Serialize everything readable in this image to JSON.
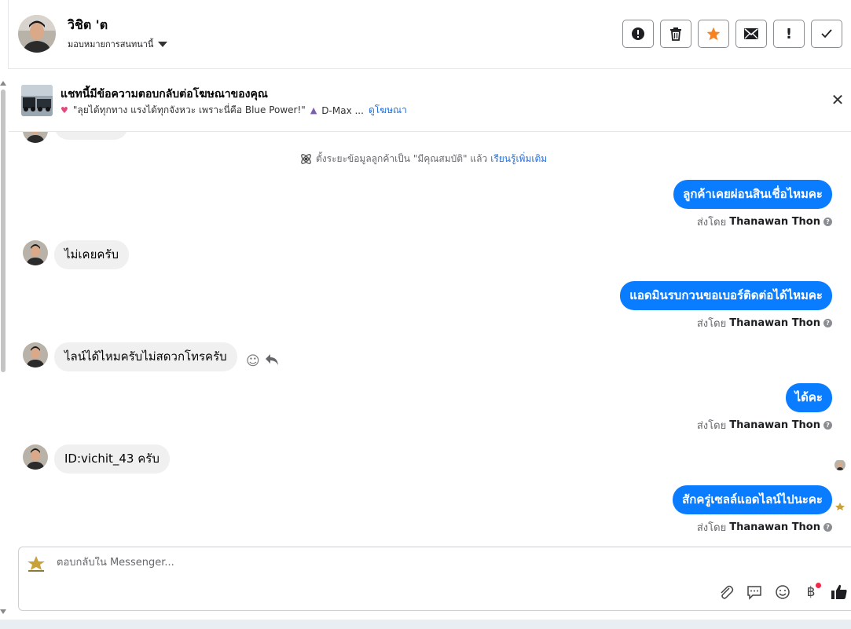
{
  "header": {
    "contact_name": "วิชิต 'ต",
    "assign_label": "มอบหมายการสนทนานี้",
    "actions": [
      {
        "name": "spam",
        "glyph": "!"
      },
      {
        "name": "trash",
        "glyph": "trash"
      },
      {
        "name": "star",
        "glyph": "★"
      },
      {
        "name": "mail",
        "glyph": "✉"
      },
      {
        "name": "follow-up",
        "glyph": "!"
      },
      {
        "name": "done",
        "glyph": "✓"
      }
    ]
  },
  "ad_banner": {
    "title": "แชทนี้มีข้อความตอบกลับต่อโฆษณาของคุณ",
    "ad_text": "\"ลุยได้ทุกทาง แรงได้ทุกจังหวะ เพราะนี่คือ Blue Power!\"",
    "ad_suffix": "D-Max ...",
    "link_label": "ดูโฆษณา"
  },
  "system_note": {
    "text": "ตั้งระยะข้อมูลลูกค้าเป็น \"มีคุณสมบัติ\" แล้ว",
    "link": "เรียนรู้เพิ่มเติม"
  },
  "messages": {
    "out_1": "ลูกค้าเคยผ่อนสินเชื่อไหมคะ",
    "in_1": "ไม่เคยครับ",
    "out_2": "แอดมินรบกวนขอเบอร์ติดต่อได้ไหมคะ",
    "in_2": "ไลน์ได้ไหมครับไม่สดวกโทรครับ",
    "out_3": "ได้คะ",
    "in_3": "ID:vichit_43 ครับ",
    "out_4": "สักครู่เซลล์แอดไลน์ไปนะคะ"
  },
  "sent_by": {
    "prefix": "ส่งโดย",
    "agent": "Thanawan Thon"
  },
  "composer": {
    "placeholder": "ตอบกลับใน Messenger..."
  },
  "colors": {
    "outgoing_bubble": "#0a7cff",
    "incoming_bubble": "#f0f0f0",
    "link": "#216fdb",
    "star": "#f5831f"
  }
}
